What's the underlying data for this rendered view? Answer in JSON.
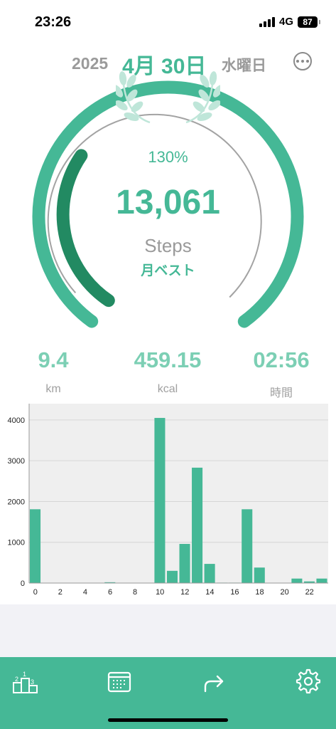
{
  "status_bar": {
    "time": "23:26",
    "network": "4G",
    "battery": "87"
  },
  "date_header": {
    "year": "2025",
    "date": "4月 30日",
    "weekday": "水曜日"
  },
  "summary": {
    "percent": "130%",
    "steps": "13,061",
    "steps_label": "Steps",
    "badge": "月ベスト",
    "goal_progress": 1.3
  },
  "stats": [
    {
      "value": "9.4",
      "unit": "km"
    },
    {
      "value": "459.15",
      "unit": "kcal"
    },
    {
      "value": "02:56",
      "unit": "時間"
    }
  ],
  "tab_bar": {
    "items": [
      {
        "name": "ranking-icon"
      },
      {
        "name": "calendar-icon"
      },
      {
        "name": "share-icon"
      },
      {
        "name": "gear-icon"
      }
    ],
    "ranking_digits": [
      "2",
      "1",
      "3"
    ]
  },
  "colors": {
    "accent": "#45b896",
    "accent_dark": "#228a62",
    "bar": "#45b896"
  },
  "chart_data": {
    "type": "bar",
    "x": [
      0,
      1,
      2,
      3,
      4,
      5,
      6,
      7,
      8,
      9,
      10,
      11,
      12,
      13,
      14,
      15,
      16,
      17,
      18,
      19,
      20,
      21,
      22,
      23
    ],
    "values": [
      1810,
      0,
      0,
      0,
      0,
      0,
      20,
      5,
      5,
      0,
      4050,
      300,
      960,
      2830,
      470,
      10,
      10,
      1810,
      380,
      0,
      0,
      110,
      40,
      110
    ],
    "x_tick_labels": [
      "0",
      "2",
      "4",
      "6",
      "8",
      "10",
      "12",
      "14",
      "16",
      "18",
      "20",
      "22"
    ],
    "y_tick_labels": [
      "0",
      "1000",
      "2000",
      "3000",
      "4000"
    ],
    "ylim": [
      0,
      4400
    ],
    "grid": true
  }
}
